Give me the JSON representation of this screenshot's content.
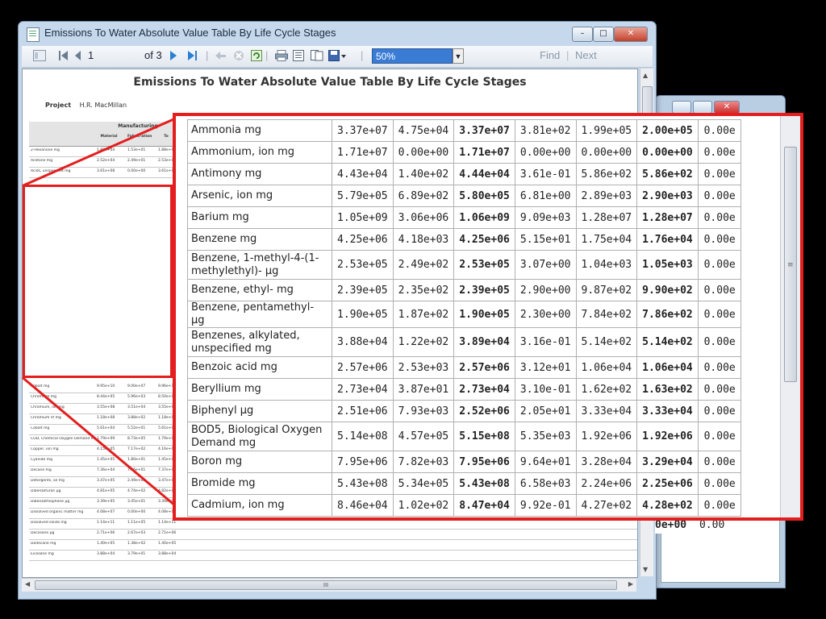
{
  "window": {
    "title": "Emissions To Water Absolute Value Table By Life Cycle Stages",
    "min_glyph": "–",
    "max_glyph": "□",
    "close_glyph": "✕"
  },
  "toolbar": {
    "page_current": "1",
    "page_of": "of 3",
    "zoom": "50%",
    "find_label": "Find",
    "next_label": "Next",
    "separator": "|"
  },
  "report": {
    "title": "Emissions To Water Absolute Value Table By Life Cycle Stages",
    "project_label": "Project",
    "project_value": "H.R. MacMillan",
    "group_header": "Manufacturing",
    "col_material": "Material",
    "col_fabrication": "Fabric-ation",
    "col_total": "To"
  },
  "small_rows_top": [
    {
      "name": "2-Hexanone mg",
      "v1": "1.88e+04",
      "v2": "1.53e+01",
      "v3": "1.88e+04"
    },
    {
      "name": "Acetone mg",
      "v1": "2.52e+04",
      "v2": "2.49e+01",
      "v3": "2.53e+04"
    },
    {
      "name": "Acids, unspecified mg",
      "v1": "3.61e+08",
      "v2": "0.00e+00",
      "v3": "3.61e+08"
    }
  ],
  "small_rows_bottom": [
    {
      "name": "Cobalt mg",
      "v1": "9.95e+10",
      "v2": "9.00e+07",
      "v3": "9.96e+10"
    },
    {
      "name": "Chromium mg",
      "v1": "8.44e+05",
      "v2": "5.96e+03",
      "v3": "8.50e+05"
    },
    {
      "name": "Chromium, ion mg",
      "v1": "3.55e+08",
      "v2": "3.51e+04",
      "v3": "3.55e+08"
    },
    {
      "name": "Chromium VI mg",
      "v1": "1.18e+08",
      "v2": "3.88e+02",
      "v3": "1.18e+08"
    },
    {
      "name": "Cobalt mg",
      "v1": "5.61e+04",
      "v2": "5.52e+01",
      "v3": "5.61e+04"
    },
    {
      "name": "COD, Chemical Oxygen Demand mg",
      "v1": "1.79e+09",
      "v2": "8.73e+05",
      "v3": "1.79e+09"
    },
    {
      "name": "Copper, ion mg",
      "v1": "4.15e+05",
      "v2": "7.17e+02",
      "v3": "4.16e+05"
    },
    {
      "name": "Cyanide mg",
      "v1": "1.45e+05",
      "v2": "1.80e+01",
      "v3": "1.45e+05"
    },
    {
      "name": "Decane mg",
      "v1": "7.36e+04",
      "v2": "7.26e+01",
      "v3": "7.37e+04"
    },
    {
      "name": "Detergents, oil mg",
      "v1": "3.47e+05",
      "v2": "2.49e+03",
      "v3": "3.47e+05"
    },
    {
      "name": "Dibenzofuran µg",
      "v1": "4.81e+05",
      "v2": "4.74e+02",
      "v3": "4.82e+05"
    },
    {
      "name": "Dibenzothiophene µg",
      "v1": "3.39e+05",
      "v2": "3.45e+01",
      "v3": "3.39e+05"
    },
    {
      "name": "Dissolved organic matter mg",
      "v1": "4.08e+07",
      "v2": "0.00e+00",
      "v3": "4.08e+07"
    },
    {
      "name": "Dissolved solids mg",
      "v1": "1.14e+11",
      "v2": "1.11e+05",
      "v3": "1.14e+11"
    },
    {
      "name": "Docosane µg",
      "v1": "2.71e+06",
      "v2": "2.67e+03",
      "v3": "2.71e+06"
    },
    {
      "name": "Dodecane mg",
      "v1": "1.40e+05",
      "v2": "1.38e+02",
      "v3": "1.40e+05"
    },
    {
      "name": "Eicosane mg",
      "v1": "3.88e+04",
      "v2": "3.79e+01",
      "v3": "3.88e+04"
    }
  ],
  "zoom_rows": [
    {
      "name": "Ammonia mg",
      "c1": "3.37e+07",
      "c2": "4.75e+04",
      "c3": "3.37e+07",
      "c4": "3.81e+02",
      "c5": "1.99e+05",
      "c6": "2.00e+05",
      "c7": "0.00e"
    },
    {
      "name": "Ammonium, ion mg",
      "c1": "1.71e+07",
      "c2": "0.00e+00",
      "c3": "1.71e+07",
      "c4": "0.00e+00",
      "c5": "0.00e+00",
      "c6": "0.00e+00",
      "c7": "0.00e"
    },
    {
      "name": "Antimony mg",
      "c1": "4.43e+04",
      "c2": "1.40e+02",
      "c3": "4.44e+04",
      "c4": "3.61e-01",
      "c5": "5.86e+02",
      "c6": "5.86e+02",
      "c7": "0.00e"
    },
    {
      "name": "Arsenic, ion mg",
      "c1": "5.79e+05",
      "c2": "6.89e+02",
      "c3": "5.80e+05",
      "c4": "6.81e+00",
      "c5": "2.89e+03",
      "c6": "2.90e+03",
      "c7": "0.00e"
    },
    {
      "name": "Barium mg",
      "c1": "1.05e+09",
      "c2": "3.06e+06",
      "c3": "1.06e+09",
      "c4": "9.09e+03",
      "c5": "1.28e+07",
      "c6": "1.28e+07",
      "c7": "0.00e"
    },
    {
      "name": "Benzene mg",
      "c1": "4.25e+06",
      "c2": "4.18e+03",
      "c3": "4.25e+06",
      "c4": "5.15e+01",
      "c5": "1.75e+04",
      "c6": "1.76e+04",
      "c7": "0.00e"
    },
    {
      "name": "Benzene, 1-methyl-4-(1-methylethyl)- µg",
      "c1": "2.53e+05",
      "c2": "2.49e+02",
      "c3": "2.53e+05",
      "c4": "3.07e+00",
      "c5": "1.04e+03",
      "c6": "1.05e+03",
      "c7": "0.00e"
    },
    {
      "name": "Benzene, ethyl- mg",
      "c1": "2.39e+05",
      "c2": "2.35e+02",
      "c3": "2.39e+05",
      "c4": "2.90e+00",
      "c5": "9.87e+02",
      "c6": "9.90e+02",
      "c7": "0.00e"
    },
    {
      "name": "Benzene, pentamethyl- µg",
      "c1": "1.90e+05",
      "c2": "1.87e+02",
      "c3": "1.90e+05",
      "c4": "2.30e+00",
      "c5": "7.84e+02",
      "c6": "7.86e+02",
      "c7": "0.00e"
    },
    {
      "name": "Benzenes, alkylated, unspecified mg",
      "c1": "3.88e+04",
      "c2": "1.22e+02",
      "c3": "3.89e+04",
      "c4": "3.16e-01",
      "c5": "5.14e+02",
      "c6": "5.14e+02",
      "c7": "0.00e"
    },
    {
      "name": "Benzoic acid mg",
      "c1": "2.57e+06",
      "c2": "2.53e+03",
      "c3": "2.57e+06",
      "c4": "3.12e+01",
      "c5": "1.06e+04",
      "c6": "1.06e+04",
      "c7": "0.00e"
    },
    {
      "name": "Beryllium mg",
      "c1": "2.73e+04",
      "c2": "3.87e+01",
      "c3": "2.73e+04",
      "c4": "3.10e-01",
      "c5": "1.62e+02",
      "c6": "1.63e+02",
      "c7": "0.00e"
    },
    {
      "name": "Biphenyl µg",
      "c1": "2.51e+06",
      "c2": "7.93e+03",
      "c3": "2.52e+06",
      "c4": "2.05e+01",
      "c5": "3.33e+04",
      "c6": "3.33e+04",
      "c7": "0.00e"
    },
    {
      "name": "BOD5, Biological Oxygen Demand mg",
      "c1": "5.14e+08",
      "c2": "4.57e+05",
      "c3": "5.15e+08",
      "c4": "5.35e+03",
      "c5": "1.92e+06",
      "c6": "1.92e+06",
      "c7": "0.00e"
    },
    {
      "name": "Boron mg",
      "c1": "7.95e+06",
      "c2": "7.82e+03",
      "c3": "7.95e+06",
      "c4": "9.64e+01",
      "c5": "3.28e+04",
      "c6": "3.29e+04",
      "c7": "0.00e"
    },
    {
      "name": "Bromide mg",
      "c1": "5.43e+08",
      "c2": "5.34e+05",
      "c3": "5.43e+08",
      "c4": "6.58e+03",
      "c5": "2.24e+06",
      "c6": "2.25e+06",
      "c7": "0.00e"
    },
    {
      "name": "Cadmium, ion mg",
      "c1": "8.46e+04",
      "c2": "1.02e+02",
      "c3": "8.47e+04",
      "c4": "9.92e-01",
      "c5": "4.27e+02",
      "c6": "4.28e+02",
      "c7": "0.00e"
    }
  ],
  "bg_window": {
    "fragment": "0e+00",
    "fragment2": "0.00",
    "close_glyph": "✕",
    "hscroll_label": "III"
  },
  "colors": {
    "highlight": "#e41e1e",
    "zoom_selected": "#3a7bd5"
  }
}
